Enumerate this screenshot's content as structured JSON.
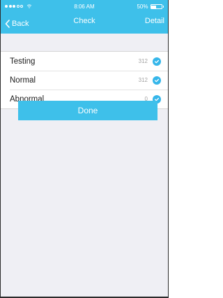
{
  "status_bar": {
    "time": "8:06 AM",
    "battery_text": "50%",
    "battery_level": 0.5,
    "signal_dots_filled": 3,
    "signal_dots_total": 5
  },
  "nav": {
    "back_label": "Back",
    "title": "Check",
    "detail_label": "Detail"
  },
  "checks": [
    {
      "label": "Testing",
      "count": "312"
    },
    {
      "label": "Normal",
      "count": "312"
    },
    {
      "label": "Abnormal",
      "count": "0"
    }
  ],
  "done_label": "Done",
  "colors": {
    "accent": "#3ec0ea",
    "check": "#35b6ea",
    "background": "#efeff4"
  }
}
